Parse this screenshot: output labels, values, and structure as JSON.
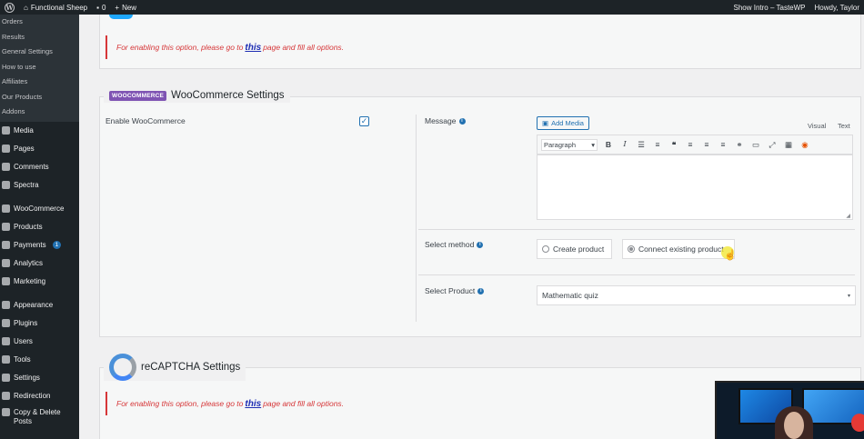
{
  "adminbar": {
    "site_name": "Functional Sheep",
    "comments_count": "0",
    "new_label": "New",
    "show_intro": "Show Intro – TasteWP",
    "howdy": "Howdy, Taylor"
  },
  "sidebar": {
    "subitems": [
      "Orders",
      "Results",
      "General Settings",
      "How to use",
      "Affiliates",
      "Our Products",
      "Addons"
    ],
    "menu": [
      {
        "label": "Media"
      },
      {
        "label": "Pages"
      },
      {
        "label": "Comments"
      },
      {
        "label": "Spectra"
      },
      {
        "label": "WooCommerce"
      },
      {
        "label": "Products"
      },
      {
        "label": "Payments",
        "badge": "1"
      },
      {
        "label": "Analytics"
      },
      {
        "label": "Marketing"
      },
      {
        "label": "Appearance"
      },
      {
        "label": "Plugins"
      },
      {
        "label": "Users"
      },
      {
        "label": "Tools"
      },
      {
        "label": "Settings"
      },
      {
        "label": "Redirection"
      },
      {
        "label": "Copy & Delete Posts"
      }
    ]
  },
  "notice": {
    "prefix": "For enabling this option, please go to",
    "link": "this",
    "suffix": "page and fill all options."
  },
  "woocommerce": {
    "logo_text": "WOOCOMMERCE",
    "title": "WooCommerce Settings",
    "enable_label": "Enable WooCommerce",
    "enable_checked": true,
    "message_label": "Message",
    "add_media": "Add Media",
    "tab_visual": "Visual",
    "tab_text": "Text",
    "paragraph": "Paragraph",
    "method_label": "Select method",
    "method_options": [
      "Create product",
      "Connect existing product"
    ],
    "method_selected": "Connect existing product",
    "product_label": "Select Product",
    "product_value": "Mathematic quiz"
  },
  "recaptcha": {
    "title": "reCAPTCHA Settings"
  },
  "icons": {
    "info": "info-icon",
    "checkbox": "checkbox-checked-icon"
  },
  "colors": {
    "accent": "#2271b1",
    "notice": "#d63638",
    "woo": "#7f54b3"
  }
}
